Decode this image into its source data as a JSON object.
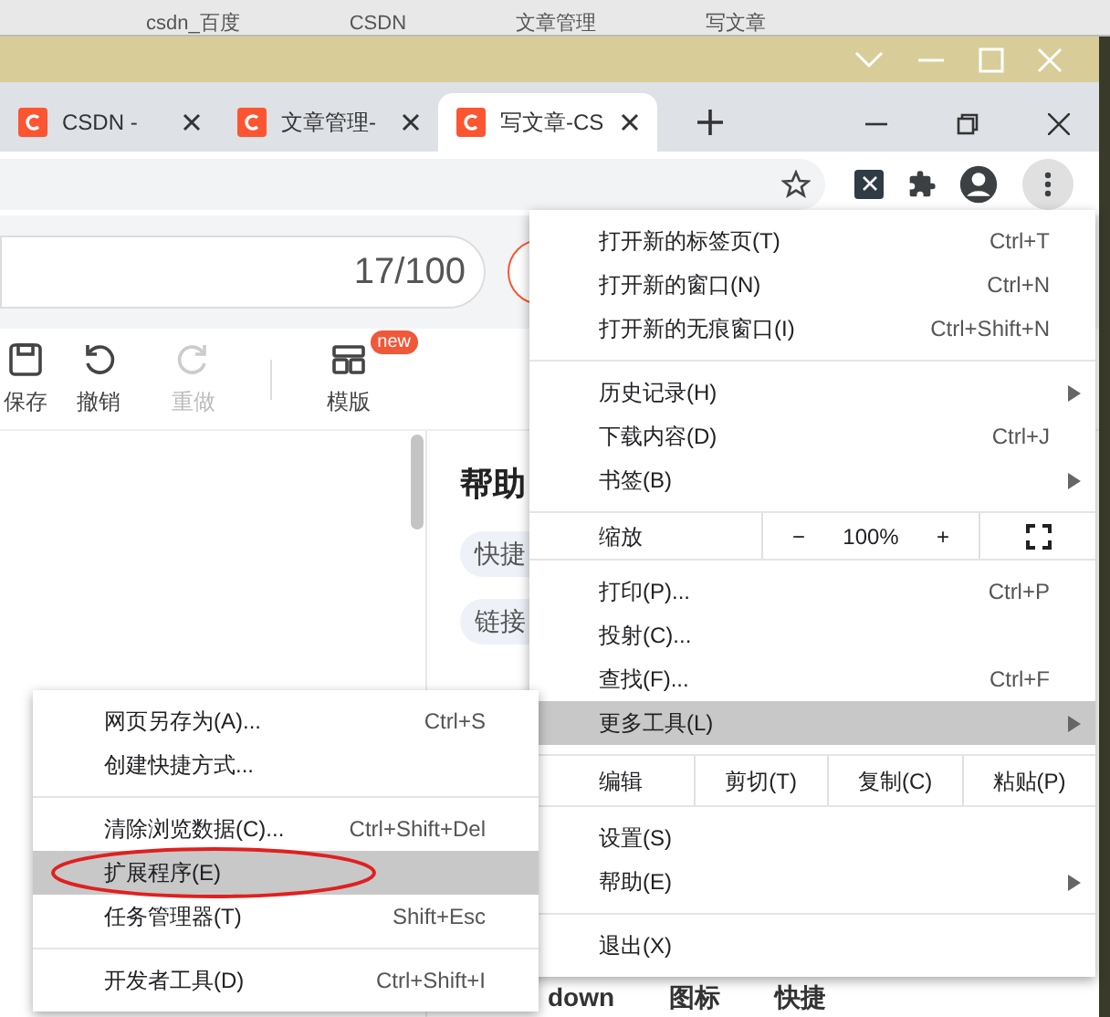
{
  "background_tabs": [
    {
      "label": "csdn_百度"
    },
    {
      "label": "CSDN"
    },
    {
      "label": "文章管理"
    },
    {
      "label": "写文章"
    }
  ],
  "tabs": [
    {
      "label": "CSDN - ",
      "selected": false
    },
    {
      "label": "文章管理-",
      "selected": false
    },
    {
      "label": "写文章-CS",
      "selected": true
    }
  ],
  "editor": {
    "counter": "17/100",
    "toolbar": [
      {
        "label": "保存",
        "disabled": false
      },
      {
        "label": "撤销",
        "disabled": false
      },
      {
        "label": "重做",
        "disabled": true
      },
      {
        "label": "模版",
        "disabled": false,
        "badge": "new"
      }
    ]
  },
  "help_panel": {
    "title": "帮助",
    "chips": [
      "快捷",
      "链接"
    ]
  },
  "bottom_labels": [
    "down",
    "图标",
    "快捷"
  ],
  "menu": {
    "sections": [
      [
        {
          "kind": "item",
          "label": "打开新的标签页(T)",
          "shortcut": "Ctrl+T",
          "submenu": false,
          "selected": false
        },
        {
          "kind": "item",
          "label": "打开新的窗口(N)",
          "shortcut": "Ctrl+N",
          "submenu": false,
          "selected": false
        },
        {
          "kind": "item",
          "label": "打开新的无痕窗口(I)",
          "shortcut": "Ctrl+Shift+N",
          "submenu": false,
          "selected": false
        }
      ],
      [
        {
          "kind": "item",
          "label": "历史记录(H)",
          "submenu": true,
          "selected": false
        },
        {
          "kind": "item",
          "label": "下载内容(D)",
          "shortcut": "Ctrl+J",
          "submenu": false,
          "selected": false
        },
        {
          "kind": "item",
          "label": "书签(B)",
          "submenu": true,
          "selected": false
        }
      ],
      [
        {
          "kind": "zoom",
          "label": "缩放",
          "minus": "−",
          "value": "100%",
          "plus": "+"
        }
      ],
      [
        {
          "kind": "item",
          "label": "打印(P)...",
          "shortcut": "Ctrl+P",
          "submenu": false,
          "selected": false
        },
        {
          "kind": "item",
          "label": "投射(C)...",
          "submenu": false,
          "selected": false
        },
        {
          "kind": "item",
          "label": "查找(F)...",
          "shortcut": "Ctrl+F",
          "submenu": false,
          "selected": false
        },
        {
          "kind": "item",
          "label": "更多工具(L)",
          "submenu": true,
          "selected": true
        }
      ],
      [
        {
          "kind": "edit",
          "label": "编辑",
          "actions": [
            "剪切(T)",
            "复制(C)",
            "粘贴(P)"
          ]
        }
      ],
      [
        {
          "kind": "item",
          "label": "设置(S)",
          "submenu": false,
          "selected": false
        },
        {
          "kind": "item",
          "label": "帮助(E)",
          "submenu": true,
          "selected": false
        }
      ],
      [
        {
          "kind": "item",
          "label": "退出(X)",
          "submenu": false,
          "selected": false
        }
      ]
    ]
  },
  "submenu": {
    "sections": [
      [
        {
          "kind": "item",
          "label": "网页另存为(A)...",
          "shortcut": "Ctrl+S",
          "selected": false,
          "circled": false
        },
        {
          "kind": "item",
          "label": "创建快捷方式...",
          "selected": false,
          "circled": false
        }
      ],
      [
        {
          "kind": "item",
          "label": "清除浏览数据(C)...",
          "shortcut": "Ctrl+Shift+Del",
          "selected": false,
          "circled": false
        },
        {
          "kind": "item",
          "label": "扩展程序(E)",
          "selected": true,
          "circled": true
        },
        {
          "kind": "item",
          "label": "任务管理器(T)",
          "shortcut": "Shift+Esc",
          "selected": false,
          "circled": false
        }
      ],
      [
        {
          "kind": "item",
          "label": "开发者工具(D)",
          "shortcut": "Ctrl+Shift+I",
          "selected": false,
          "circled": false
        }
      ]
    ]
  }
}
